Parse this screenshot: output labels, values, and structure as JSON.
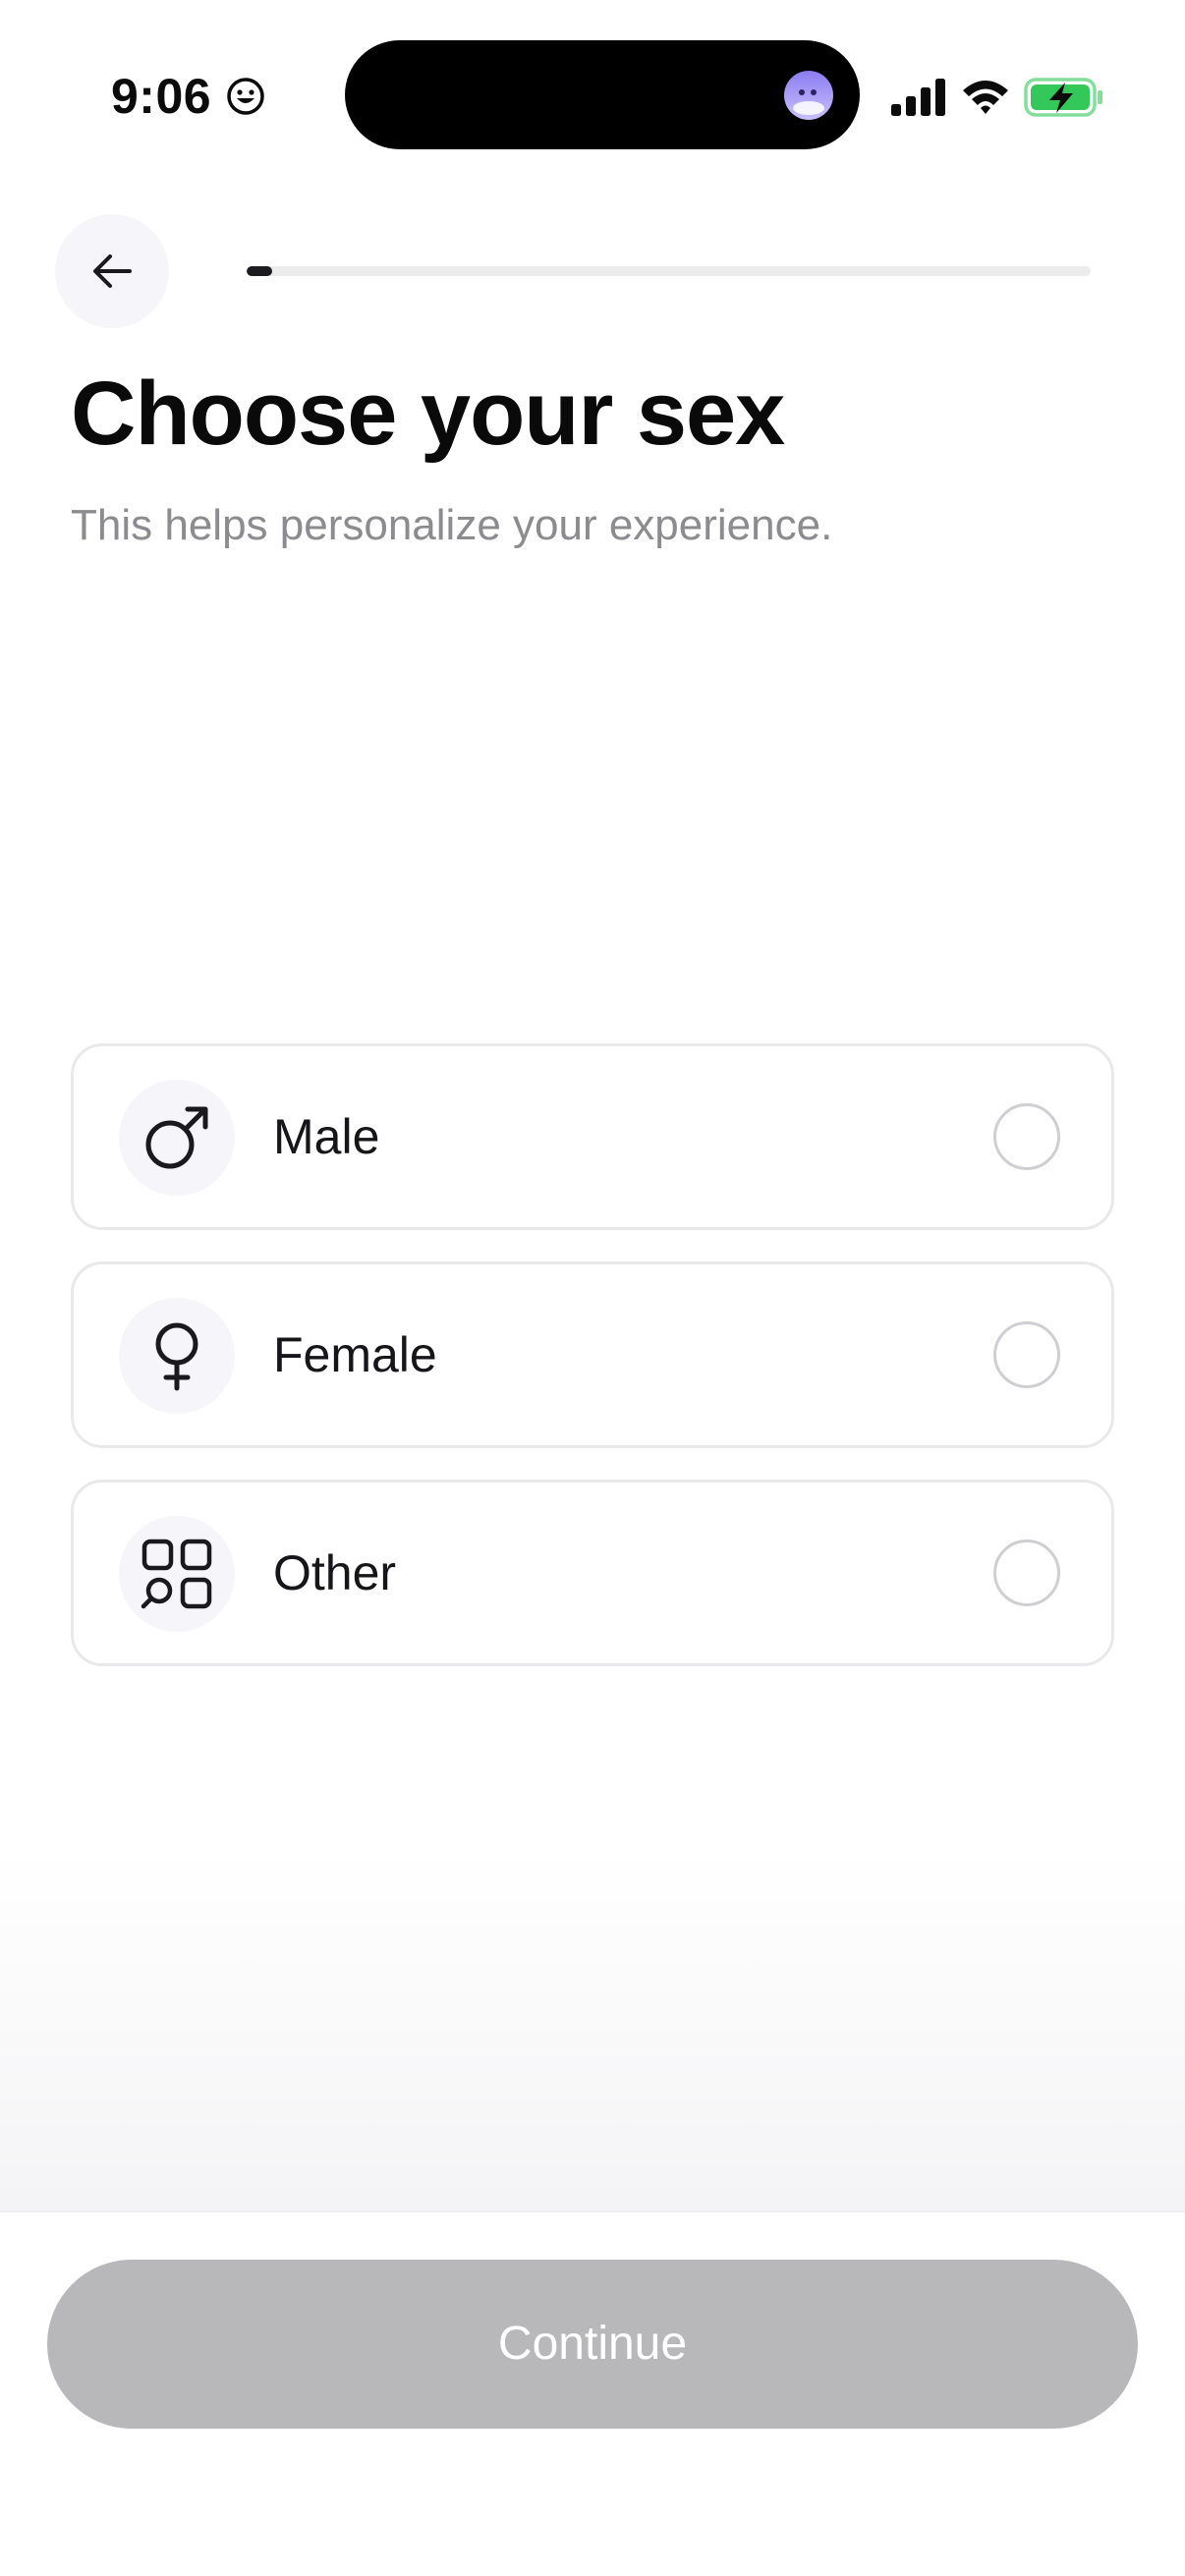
{
  "status_bar": {
    "time": "9:06",
    "icons": [
      "smiley-icon",
      "island-avatar-icon",
      "signal-icon",
      "wifi-icon",
      "battery-charging-icon"
    ],
    "battery_color": "#34c759"
  },
  "header": {
    "back_icon": "arrow-left-icon",
    "progress": 0.03
  },
  "title": "Choose your sex",
  "subtitle": "This helps personalize your experience.",
  "options": [
    {
      "label": "Male",
      "icon": "male-symbol-icon",
      "selected": false
    },
    {
      "label": "Female",
      "icon": "female-symbol-icon",
      "selected": false
    },
    {
      "label": "Other",
      "icon": "other-grid-icon",
      "selected": false
    }
  ],
  "footer": {
    "continue_label": "Continue",
    "enabled": false
  },
  "colors": {
    "accent": "#1b1b20",
    "disabled_button": "#b8b8ba",
    "icon_bg": "#f6f6fa",
    "subtitle": "#8b8b90"
  }
}
